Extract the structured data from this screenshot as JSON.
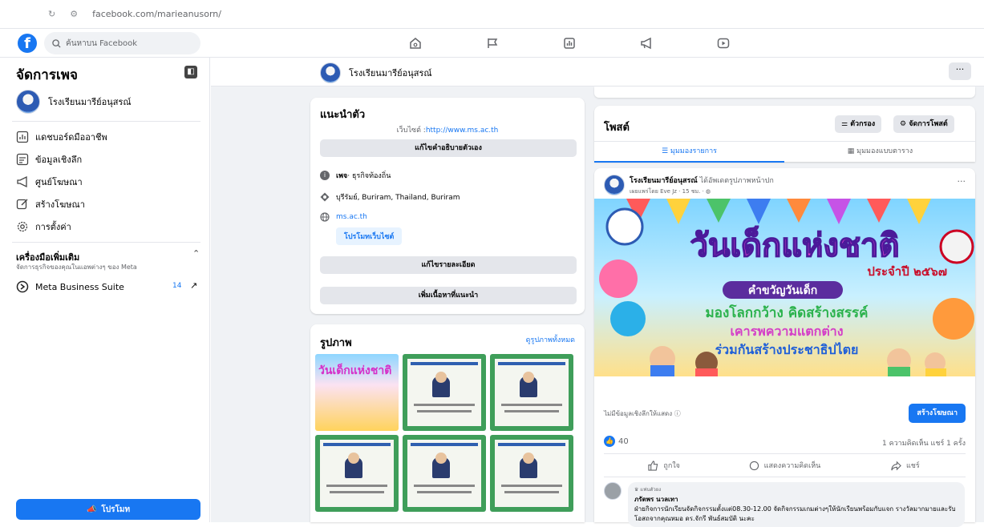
{
  "browser": {
    "url": "facebook.com/marieanusorn/"
  },
  "topbar": {
    "search_placeholder": "ค้นหาบน Facebook",
    "nav_icons": [
      "home-icon",
      "flag-icon",
      "insights-icon",
      "megaphone-icon",
      "video-icon"
    ]
  },
  "sidebar": {
    "title": "จัดการเพจ",
    "page_name": "โรงเรียนมารีย์อนุสรณ์",
    "items": [
      {
        "label": "แดชบอร์ดมืออาชีพ",
        "icon": "dashboard-icon"
      },
      {
        "label": "ข้อมูลเชิงลึก",
        "icon": "insights-icon"
      },
      {
        "label": "ศูนย์โฆษณา",
        "icon": "megaphone-icon"
      },
      {
        "label": "สร้างโฆษณา",
        "icon": "edit-icon"
      },
      {
        "label": "การตั้งค่า",
        "icon": "gear-icon"
      }
    ],
    "more_tools_title": "เครื่องมือเพิ่มเติม",
    "more_tools_desc": "จัดการธุรกิจของคุณในแอพต่างๆ ของ Meta",
    "mbs_label": "Meta Business Suite",
    "mbs_count": "14",
    "promote_label": "โปรโมท"
  },
  "page_header": {
    "name": "โรงเรียนมารีย์อนุสรณ์"
  },
  "intro": {
    "title": "แนะนำตัว",
    "website_prefix": "เว็บไซต์ :",
    "website_url": "http://www.ms.ac.th",
    "edit_bio_label": "แก้ไขคำอธิบายตัวเอง",
    "category_bold": "เพจ",
    "category_text": " · ธุรกิจท้องถิ่น",
    "location": "บุรีรัมย์, Buriram, Thailand, Buriram",
    "site": "ms.ac.th",
    "promote_web_label": "โปรโมทเว็บไซต์",
    "edit_details_label": "แก้ไขรายละเอียด",
    "add_featured_label": "เพิ่มเนื้อหาที่แนะนำ"
  },
  "photos": {
    "title": "รูปภาพ",
    "see_all": "ดูรูปภาพทั้งหมด",
    "poster_title": "วันเด็กแห่งชาติ"
  },
  "posts": {
    "title": "โพสต์",
    "filter_label": "ตัวกรอง",
    "manage_label": "จัดการโพสต์",
    "tab_list": "มุมมองรายการ",
    "tab_grid": "มุมมองแบบตาราง"
  },
  "post": {
    "author": "โรงเรียนมารีย์อนุสรณ์",
    "action": " ได้อัพเดตรูปภาพหน้าปก",
    "meta": "เผยแพร่โดย Eve Jz · 15 ชม. ·",
    "banner": {
      "title": "วันเด็กแห่งชาติ",
      "year": "ประจำปี ๒๕๖๗",
      "line1": "คำขวัญวันเด็ก",
      "line2": "มองโลกกว้าง คิดสร้างสรรค์",
      "line3": "เคารพความแตกต่าง",
      "line4": "ร่วมกันสร้างประชาธิปไตย"
    },
    "no_insights": "ไม่มีข้อมูลเชิงลึกให้แสดง",
    "boost_label": "สร้างโฆษณา",
    "reaction_count": "40",
    "comments_shares": "1 ความคิดเห็น  แชร์ 1 ครั้ง",
    "like_label": "ถูกใจ",
    "comment_label": "แสดงความคิดเห็น",
    "share_label": "แชร์"
  },
  "comment": {
    "tag": "แฟนตัวยง",
    "name": "ภรัตพร นวลเทา",
    "text": "ฝ่ายกิจการนักเรียนจัดกิจกรรมตั้งแต่08.30-12.00 จัดกิจกรรมเกมต่างๆให้นักเรียนพร้อมกับแจก รางวัลมากมายและรับโอสถจากคุณหมอ ดร.จักรี พันธ์สมบัติ นะคะ"
  },
  "colors": {
    "accent": "#1877f2",
    "bg": "#f0f2f5"
  }
}
